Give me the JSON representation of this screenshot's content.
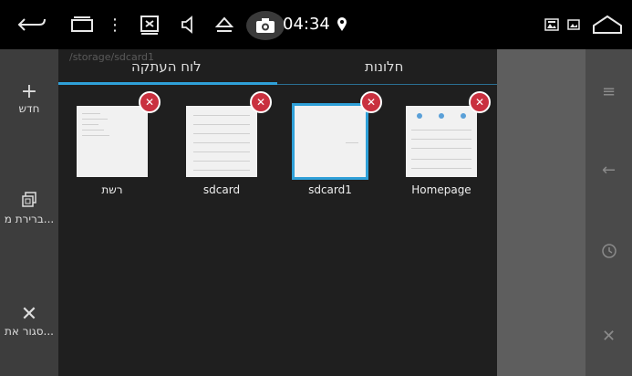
{
  "status_bar": {
    "time": "04:34",
    "icons": [
      "back-icon",
      "recent-apps-icon",
      "menu-dots-icon",
      "screenshot-box-icon",
      "volume-icon",
      "eject-icon",
      "camera-icon",
      "location-pin-icon",
      "gallery-icon",
      "image-icon",
      "home-icon"
    ]
  },
  "left_panel": {
    "items": [
      {
        "label": "חדש",
        "icon": "plus-icon"
      },
      {
        "label": "ברירת מ...",
        "icon": "copy-icon"
      },
      {
        "label": "סגור את...",
        "icon": "close-icon"
      }
    ]
  },
  "path_text": "/storage/sdcard1",
  "tabs": {
    "clipboard": "לוח העתקה",
    "windows": "חלונות"
  },
  "windows": [
    {
      "caption": "רשת"
    },
    {
      "caption": "sdcard"
    },
    {
      "caption": "sdcard1"
    },
    {
      "caption": "Homepage"
    }
  ],
  "nav_icons": [
    "menu-icon",
    "back-arrow-icon",
    "history-icon",
    "close-icon"
  ],
  "colors": {
    "accent": "#2fa0d8",
    "close_badge": "#c9303f"
  }
}
